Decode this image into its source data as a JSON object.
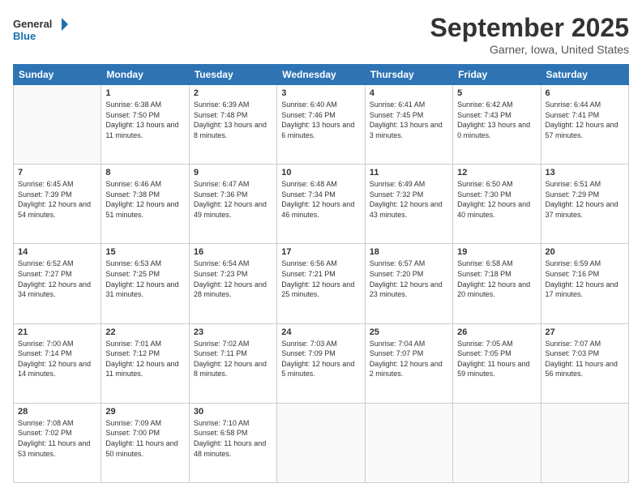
{
  "header": {
    "logo_line1": "General",
    "logo_line2": "Blue",
    "month": "September 2025",
    "location": "Garner, Iowa, United States"
  },
  "weekdays": [
    "Sunday",
    "Monday",
    "Tuesday",
    "Wednesday",
    "Thursday",
    "Friday",
    "Saturday"
  ],
  "weeks": [
    [
      {
        "day": "",
        "sunrise": "",
        "sunset": "",
        "daylight": ""
      },
      {
        "day": "1",
        "sunrise": "Sunrise: 6:38 AM",
        "sunset": "Sunset: 7:50 PM",
        "daylight": "Daylight: 13 hours and 11 minutes."
      },
      {
        "day": "2",
        "sunrise": "Sunrise: 6:39 AM",
        "sunset": "Sunset: 7:48 PM",
        "daylight": "Daylight: 13 hours and 8 minutes."
      },
      {
        "day": "3",
        "sunrise": "Sunrise: 6:40 AM",
        "sunset": "Sunset: 7:46 PM",
        "daylight": "Daylight: 13 hours and 6 minutes."
      },
      {
        "day": "4",
        "sunrise": "Sunrise: 6:41 AM",
        "sunset": "Sunset: 7:45 PM",
        "daylight": "Daylight: 13 hours and 3 minutes."
      },
      {
        "day": "5",
        "sunrise": "Sunrise: 6:42 AM",
        "sunset": "Sunset: 7:43 PM",
        "daylight": "Daylight: 13 hours and 0 minutes."
      },
      {
        "day": "6",
        "sunrise": "Sunrise: 6:44 AM",
        "sunset": "Sunset: 7:41 PM",
        "daylight": "Daylight: 12 hours and 57 minutes."
      }
    ],
    [
      {
        "day": "7",
        "sunrise": "Sunrise: 6:45 AM",
        "sunset": "Sunset: 7:39 PM",
        "daylight": "Daylight: 12 hours and 54 minutes."
      },
      {
        "day": "8",
        "sunrise": "Sunrise: 6:46 AM",
        "sunset": "Sunset: 7:38 PM",
        "daylight": "Daylight: 12 hours and 51 minutes."
      },
      {
        "day": "9",
        "sunrise": "Sunrise: 6:47 AM",
        "sunset": "Sunset: 7:36 PM",
        "daylight": "Daylight: 12 hours and 49 minutes."
      },
      {
        "day": "10",
        "sunrise": "Sunrise: 6:48 AM",
        "sunset": "Sunset: 7:34 PM",
        "daylight": "Daylight: 12 hours and 46 minutes."
      },
      {
        "day": "11",
        "sunrise": "Sunrise: 6:49 AM",
        "sunset": "Sunset: 7:32 PM",
        "daylight": "Daylight: 12 hours and 43 minutes."
      },
      {
        "day": "12",
        "sunrise": "Sunrise: 6:50 AM",
        "sunset": "Sunset: 7:30 PM",
        "daylight": "Daylight: 12 hours and 40 minutes."
      },
      {
        "day": "13",
        "sunrise": "Sunrise: 6:51 AM",
        "sunset": "Sunset: 7:29 PM",
        "daylight": "Daylight: 12 hours and 37 minutes."
      }
    ],
    [
      {
        "day": "14",
        "sunrise": "Sunrise: 6:52 AM",
        "sunset": "Sunset: 7:27 PM",
        "daylight": "Daylight: 12 hours and 34 minutes."
      },
      {
        "day": "15",
        "sunrise": "Sunrise: 6:53 AM",
        "sunset": "Sunset: 7:25 PM",
        "daylight": "Daylight: 12 hours and 31 minutes."
      },
      {
        "day": "16",
        "sunrise": "Sunrise: 6:54 AM",
        "sunset": "Sunset: 7:23 PM",
        "daylight": "Daylight: 12 hours and 28 minutes."
      },
      {
        "day": "17",
        "sunrise": "Sunrise: 6:56 AM",
        "sunset": "Sunset: 7:21 PM",
        "daylight": "Daylight: 12 hours and 25 minutes."
      },
      {
        "day": "18",
        "sunrise": "Sunrise: 6:57 AM",
        "sunset": "Sunset: 7:20 PM",
        "daylight": "Daylight: 12 hours and 23 minutes."
      },
      {
        "day": "19",
        "sunrise": "Sunrise: 6:58 AM",
        "sunset": "Sunset: 7:18 PM",
        "daylight": "Daylight: 12 hours and 20 minutes."
      },
      {
        "day": "20",
        "sunrise": "Sunrise: 6:59 AM",
        "sunset": "Sunset: 7:16 PM",
        "daylight": "Daylight: 12 hours and 17 minutes."
      }
    ],
    [
      {
        "day": "21",
        "sunrise": "Sunrise: 7:00 AM",
        "sunset": "Sunset: 7:14 PM",
        "daylight": "Daylight: 12 hours and 14 minutes."
      },
      {
        "day": "22",
        "sunrise": "Sunrise: 7:01 AM",
        "sunset": "Sunset: 7:12 PM",
        "daylight": "Daylight: 12 hours and 11 minutes."
      },
      {
        "day": "23",
        "sunrise": "Sunrise: 7:02 AM",
        "sunset": "Sunset: 7:11 PM",
        "daylight": "Daylight: 12 hours and 8 minutes."
      },
      {
        "day": "24",
        "sunrise": "Sunrise: 7:03 AM",
        "sunset": "Sunset: 7:09 PM",
        "daylight": "Daylight: 12 hours and 5 minutes."
      },
      {
        "day": "25",
        "sunrise": "Sunrise: 7:04 AM",
        "sunset": "Sunset: 7:07 PM",
        "daylight": "Daylight: 12 hours and 2 minutes."
      },
      {
        "day": "26",
        "sunrise": "Sunrise: 7:05 AM",
        "sunset": "Sunset: 7:05 PM",
        "daylight": "Daylight: 11 hours and 59 minutes."
      },
      {
        "day": "27",
        "sunrise": "Sunrise: 7:07 AM",
        "sunset": "Sunset: 7:03 PM",
        "daylight": "Daylight: 11 hours and 56 minutes."
      }
    ],
    [
      {
        "day": "28",
        "sunrise": "Sunrise: 7:08 AM",
        "sunset": "Sunset: 7:02 PM",
        "daylight": "Daylight: 11 hours and 53 minutes."
      },
      {
        "day": "29",
        "sunrise": "Sunrise: 7:09 AM",
        "sunset": "Sunset: 7:00 PM",
        "daylight": "Daylight: 11 hours and 50 minutes."
      },
      {
        "day": "30",
        "sunrise": "Sunrise: 7:10 AM",
        "sunset": "Sunset: 6:58 PM",
        "daylight": "Daylight: 11 hours and 48 minutes."
      },
      {
        "day": "",
        "sunrise": "",
        "sunset": "",
        "daylight": ""
      },
      {
        "day": "",
        "sunrise": "",
        "sunset": "",
        "daylight": ""
      },
      {
        "day": "",
        "sunrise": "",
        "sunset": "",
        "daylight": ""
      },
      {
        "day": "",
        "sunrise": "",
        "sunset": "",
        "daylight": ""
      }
    ]
  ]
}
